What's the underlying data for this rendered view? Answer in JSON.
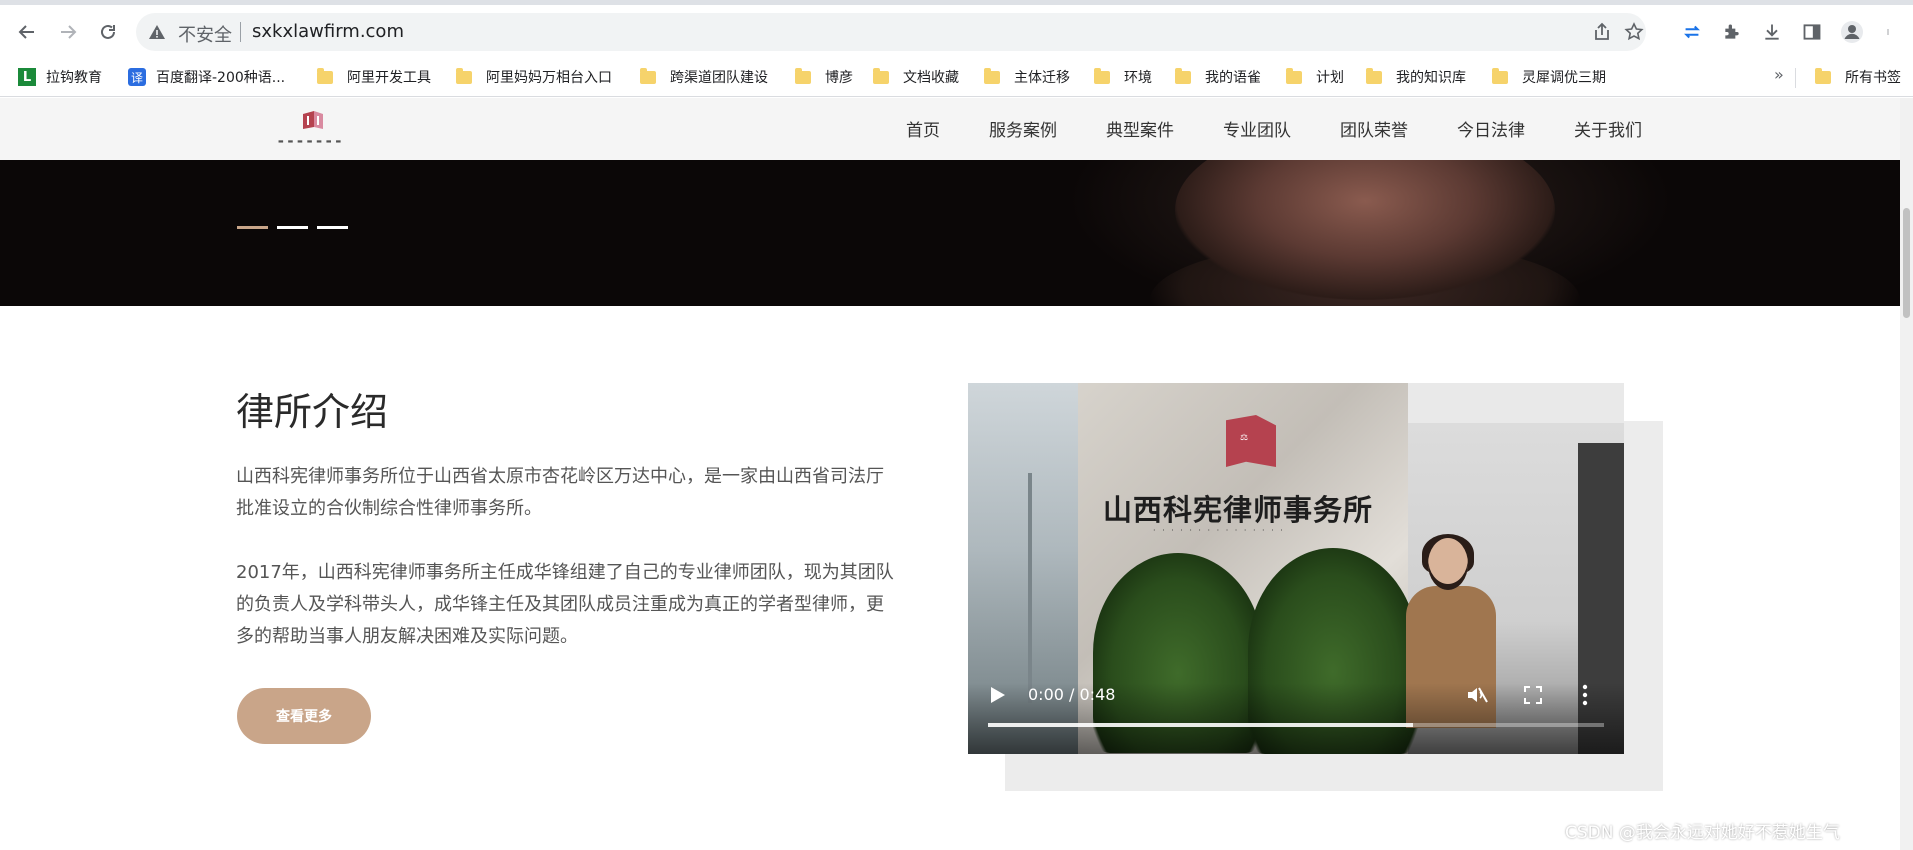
{
  "browser": {
    "security_label": "不安全",
    "url": "sxkxlawfirm.com",
    "bookmarks": [
      {
        "label": "拉钩教育"
      },
      {
        "label": "百度翻译-200种语..."
      },
      {
        "label": "阿里开发工具"
      },
      {
        "label": "阿里妈妈万相台入口"
      },
      {
        "label": "跨渠道团队建设"
      },
      {
        "label": "博彦"
      },
      {
        "label": "文档收藏"
      },
      {
        "label": "主体迁移"
      },
      {
        "label": "环境"
      },
      {
        "label": "我的语雀"
      },
      {
        "label": "计划"
      },
      {
        "label": "我的知识库"
      },
      {
        "label": "灵犀调优三期"
      }
    ],
    "bookmarks_more": "»",
    "all_bookmarks": "所有书签"
  },
  "site": {
    "nav": [
      "首页",
      "服务案例",
      "典型案件",
      "专业团队",
      "团队荣誉",
      "今日法律",
      "关于我们"
    ],
    "hero": {
      "slides": 3,
      "active_slide": 1
    }
  },
  "intro": {
    "title": "律所介绍",
    "paragraph1": "山西科宪律师事务所位于山西省太原市杏花岭区万达中心，是一家由山西省司法厅批准设立的合伙制综合性律师事务所。",
    "paragraph2": "2017年，山西科宪律师事务所主任成华锋组建了自己的专业律师团队，现为其团队的负责人及学科带头人，成华锋主任及其团队成员注重成为真正的学者型律师，更多的帮助当事人朋友解决困难及实际问题。",
    "more_button": "查看更多"
  },
  "video": {
    "sign_text": "山西科宪律师事务所",
    "time": "0:00 / 0:48",
    "buffered_fraction": 0.69,
    "muted": true
  },
  "watermark": "CSDN @我会永远对她好不惹她生气",
  "colors": {
    "accent": "#c9a589",
    "hero_bg": "#0b0707"
  }
}
